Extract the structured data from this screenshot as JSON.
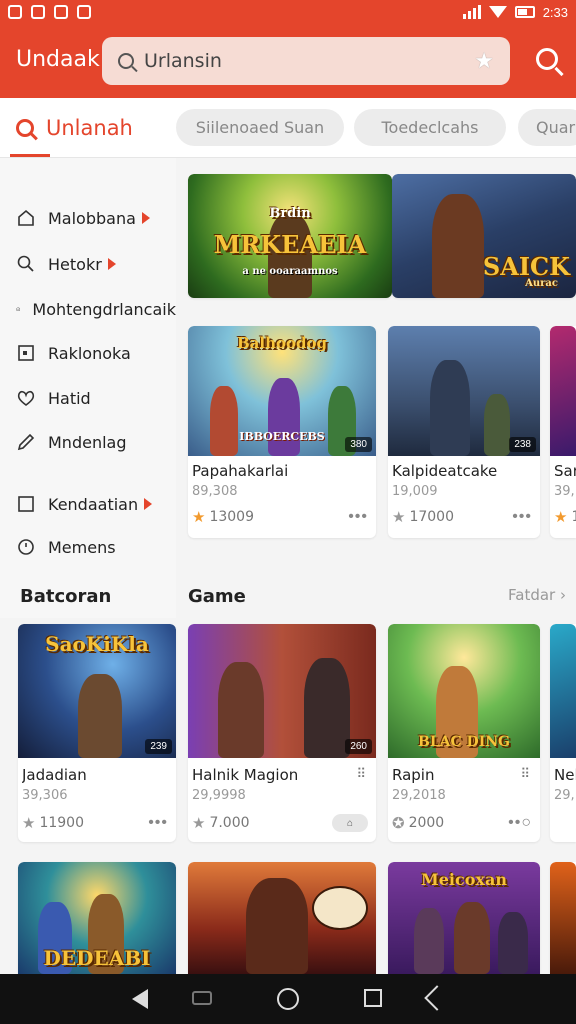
{
  "status": {
    "time": "2:33"
  },
  "appbar": {
    "brand": "Undaak",
    "search_value": "Urlansin",
    "search_placeholder": "Urlansin",
    "accent": "#e4452c"
  },
  "tabs": {
    "active": "Unlanah",
    "chips": [
      "Siilenoaed Suan",
      "Toedeclcahs",
      "Quar"
    ]
  },
  "sidebar": {
    "items": [
      {
        "label": "Malobbana",
        "icon": "home-icon",
        "arrow": true
      },
      {
        "label": "Hetokr",
        "icon": "search-icon",
        "arrow": true
      },
      {
        "label": "Mohtengdrlancaik",
        "icon": "mail-check-icon",
        "arrow": false
      },
      {
        "label": "Raklonoka",
        "icon": "calendar-icon",
        "arrow": false
      },
      {
        "label": "Hatid",
        "icon": "heart-icon",
        "arrow": false
      },
      {
        "label": "Mndenlag",
        "icon": "pencil-icon",
        "arrow": false
      },
      {
        "label": "Kendaatian",
        "icon": "checkbox-icon",
        "arrow": true
      },
      {
        "label": "Memens",
        "icon": "clock-icon",
        "arrow": false
      }
    ]
  },
  "banner": {
    "left_title": "MRKEAEIA",
    "left_sub": "Brdin",
    "left_caption": "a ne ooaraamnos",
    "right_title": "SAICK",
    "right_sub": "Aurac"
  },
  "row1": {
    "cards": [
      {
        "title": "Papahakarlai",
        "sub": "89,308",
        "rating": "13009",
        "badge": "380",
        "art_title": "Balhoodog",
        "art_caption": "IBBOERCEBS"
      },
      {
        "title": "Kalpideatcake",
        "sub": "19,009",
        "rating": "17000",
        "badge": "238",
        "art_title": "",
        "art_caption": ""
      },
      {
        "title": "Sar",
        "sub": "39,",
        "rating": "1",
        "badge": "",
        "art_title": "",
        "art_caption": ""
      }
    ]
  },
  "sections": {
    "left_title": "Batcoran",
    "game_title": "Game",
    "see_all": "Fatdar"
  },
  "row2": {
    "cards": [
      {
        "title": "Jadadian",
        "sub": "39,306",
        "rating": "11900",
        "badge": "239",
        "art_title": "SaoKiKla",
        "art_caption": ""
      },
      {
        "title": "Halnik Magion",
        "sub": "29,9998",
        "rating": "7.000",
        "badge": "260",
        "art_title": "",
        "art_caption": ""
      },
      {
        "title": "Rapin",
        "sub": "29,2018",
        "rating": "2000",
        "badge": "",
        "art_title": "",
        "art_caption": "BLAC DING"
      },
      {
        "title": "Nel",
        "sub": "29,",
        "rating": "",
        "badge": "",
        "art_title": "",
        "art_caption": ""
      }
    ]
  },
  "row3": {
    "cards": [
      {
        "art_title": "DEDEABI"
      },
      {
        "art_title": ""
      },
      {
        "art_title": "Meicoxan"
      }
    ]
  }
}
